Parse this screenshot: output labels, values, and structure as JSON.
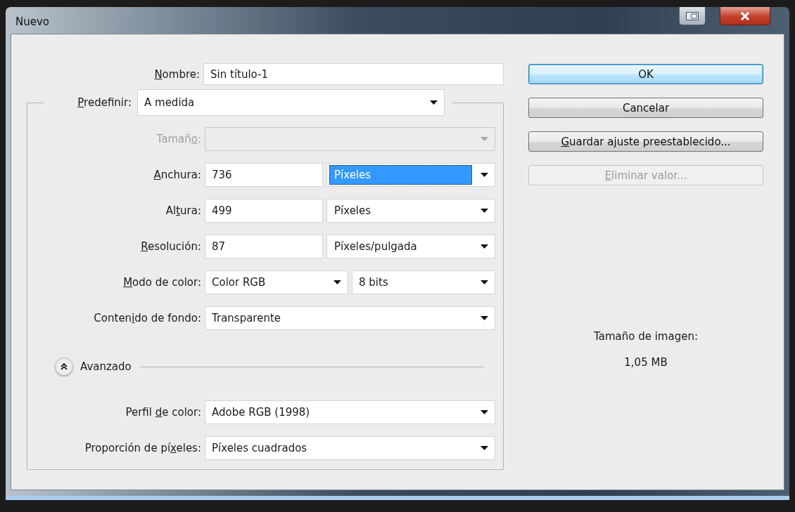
{
  "window": {
    "title": "Nuevo"
  },
  "name_field": {
    "label": {
      "key": "N",
      "after": "ombre:"
    },
    "value": "Sin título-1"
  },
  "preset": {
    "label": {
      "key": "P",
      "after": "redefinir:"
    },
    "value": "A medida"
  },
  "rows": [
    {
      "kind": "select",
      "label": {
        "before": "Tamañ",
        "key": "o",
        "after": ":"
      },
      "disabled": true
    },
    {
      "kind": "input_unit",
      "label": {
        "key": "A",
        "after": "nchura:"
      },
      "value": "736",
      "unit": "Píxeles",
      "unit_selected": true,
      "disabled": false
    },
    {
      "kind": "input_unit",
      "label": {
        "before": "Al",
        "key": "t",
        "after": "ura:"
      },
      "value": "499",
      "unit": "Píxeles",
      "unit_selected": false,
      "disabled": false
    },
    {
      "kind": "input_unit",
      "label": {
        "key": "R",
        "after": "esolución:"
      },
      "value": "87",
      "unit": "Píxeles/pulgada",
      "unit_selected": false,
      "disabled": false
    },
    {
      "kind": "select_pair",
      "label": {
        "key": "M",
        "after": "odo de color:"
      },
      "value": "Color RGB",
      "unit": "8 bits",
      "disabled": false
    },
    {
      "kind": "select",
      "label": {
        "before": "Conten",
        "key": "i",
        "after": "do de fondo:"
      },
      "value": "Transparente",
      "disabled": false
    }
  ],
  "advanced": {
    "label": "Avanzado",
    "expanded": true
  },
  "advanced_rows": [
    {
      "kind": "select",
      "label": {
        "before": "Perfil ",
        "key": "d",
        "after": "e color:"
      },
      "value": "Adobe RGB (1998)",
      "disabled": false
    },
    {
      "kind": "select",
      "label": {
        "before": "Proporción de pí",
        "key": "x",
        "after": "eles:"
      },
      "value": "Píxeles cuadrados",
      "disabled": false
    }
  ],
  "buttons": [
    {
      "label": {
        "after": "OK"
      },
      "default": true,
      "disabled": false
    },
    {
      "label": {
        "after": "Cancelar"
      },
      "default": false,
      "disabled": false
    },
    {
      "label": {
        "key": "G",
        "after": "uardar ajuste preestablecido..."
      },
      "default": false,
      "disabled": false
    },
    {
      "label": {
        "key": "E",
        "after": "liminar valor..."
      },
      "default": false,
      "disabled": true
    }
  ],
  "image_size": {
    "label": "Tamaño de imagen:",
    "value": "1,05 MB"
  }
}
